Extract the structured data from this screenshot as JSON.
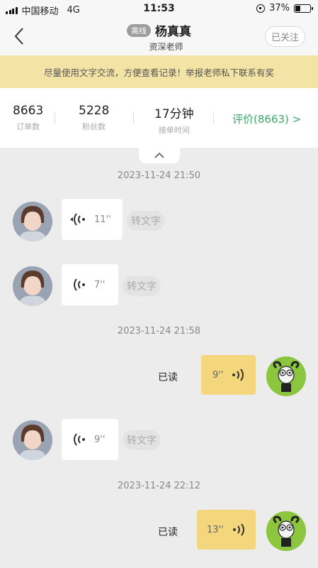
{
  "status_bar": {
    "carrier": "中国移动",
    "network": "4G",
    "time": "11:53",
    "battery": "37%",
    "battery_level": 0.37
  },
  "header": {
    "back_icon": "chevron-left-icon",
    "status_badge": "离线",
    "name": "杨真真",
    "subtitle": "资深老师",
    "follow_button": "已关注"
  },
  "banner": {
    "text": "尽量使用文字交流，方便查看记录！举报老师私下联系有奖"
  },
  "stats": {
    "items": [
      {
        "value": "8663",
        "label": "订单数"
      },
      {
        "value": "5228",
        "label": "粉丝数"
      },
      {
        "value": "17分钟",
        "label": "接单时间"
      }
    ],
    "rating_link": "评价(8663) >",
    "rating_color": "#3aa86a"
  },
  "chat": {
    "timestamps": [
      "2023-11-24 21:50",
      "2023-11-24 21:58",
      "2023-11-24 22:12"
    ],
    "messages": [
      {
        "side": "left",
        "duration": "11''",
        "convert_label": "转文字"
      },
      {
        "side": "left",
        "duration": "7''",
        "convert_label": "转文字"
      },
      {
        "side": "right",
        "duration": "9''",
        "read_label": "已读"
      },
      {
        "side": "left",
        "duration": "9''",
        "convert_label": "转文字"
      },
      {
        "side": "right",
        "duration": "13''",
        "read_label": "已读"
      }
    ],
    "bubble_me_color": "#f4d77c",
    "avatar_me_color": "#8cc63f"
  }
}
